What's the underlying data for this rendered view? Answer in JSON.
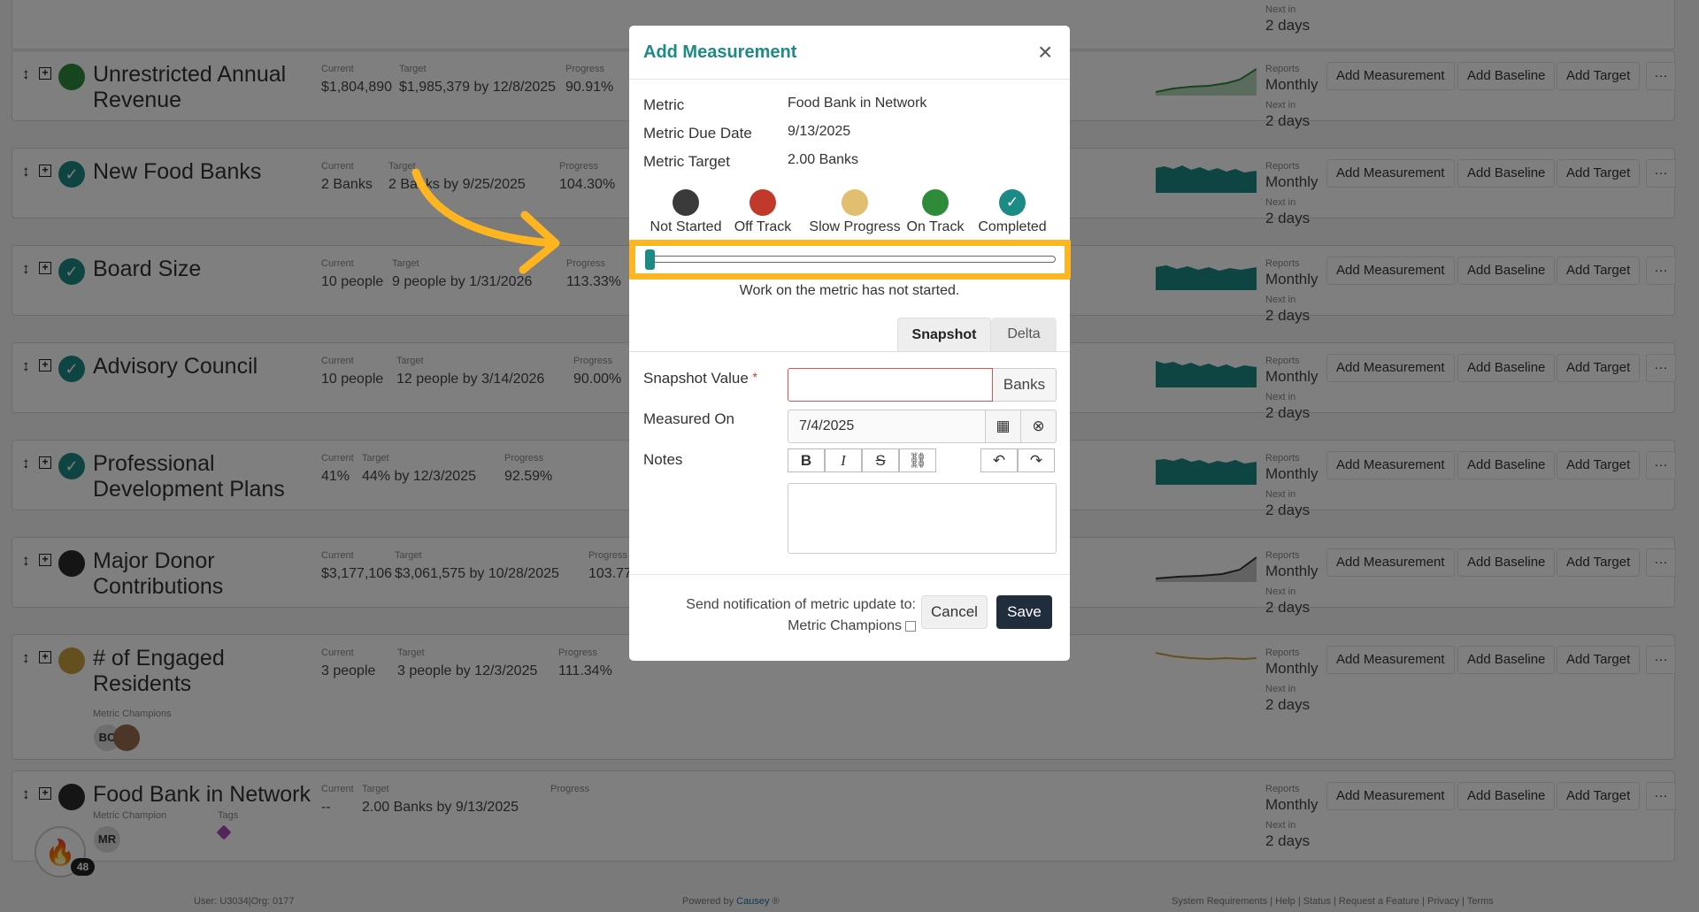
{
  "rows": [
    {
      "name": "",
      "status_color": "#bbb"
    },
    {
      "name": "Unrestricted Annual Revenue",
      "status_color": "#2e8b3a",
      "status_check": "",
      "current_label": "Current",
      "current_value": "$1,804,890",
      "target_label": "Target",
      "target_value": "$1,985,379 by 12/8/2025",
      "progress_label": "Progress",
      "progress_value": "90.91%",
      "spark_color": "#2e8b3a"
    },
    {
      "name": "New Food Banks",
      "status_color": "#1d8b85",
      "status_check": "✓",
      "current_label": "Current",
      "current_value": "2 Banks",
      "target_label": "Target",
      "target_value": "2 Banks by 9/25/2025",
      "progress_label": "Progress",
      "progress_value": "104.30%",
      "spark_color": "#1d8b85"
    },
    {
      "name": "Board Size",
      "status_color": "#1d8b85",
      "status_check": "✓",
      "current_label": "Current",
      "current_value": "10 people",
      "target_label": "Target",
      "target_value": "9 people by 1/31/2026",
      "progress_label": "Progress",
      "progress_value": "113.33%",
      "spark_color": "#1d8b85"
    },
    {
      "name": "Advisory Council",
      "status_color": "#1d8b85",
      "status_check": "✓",
      "current_label": "Current",
      "current_value": "10 people",
      "target_label": "Target",
      "target_value": "12 people by 3/14/2026",
      "progress_label": "Progress",
      "progress_value": "90.00%",
      "spark_color": "#1d8b85"
    },
    {
      "name": "Professional Development Plans",
      "status_color": "#1d8b85",
      "status_check": "✓",
      "current_label": "Current",
      "current_value": "41%",
      "target_label": "Target",
      "target_value": "44% by 12/3/2025",
      "progress_label": "Progress",
      "progress_value": "92.59%",
      "spark_color": "#1d8b85"
    },
    {
      "name": "Major Donor Contributions",
      "status_color": "#2b2b2b",
      "status_check": "",
      "current_label": "Current",
      "current_value": "$3,177,106",
      "target_label": "Target",
      "target_value": "$3,061,575 by 10/28/2025",
      "progress_label": "Progress",
      "progress_value": "103.77",
      "spark_color": "#333"
    },
    {
      "name": "# of Engaged Residents",
      "status_color": "#c8a03d",
      "status_check": "",
      "current_label": "Current",
      "current_value": "3 people",
      "target_label": "Target",
      "target_value": "3 people by 12/3/2025",
      "progress_label": "Progress",
      "progress_value": "111.34%",
      "spark_color": "#c8a03d",
      "champions_label": "Metric Champions",
      "champion_initials": "BC"
    },
    {
      "name": "Food Bank in Network",
      "status_color": "#2b2b2b",
      "status_check": "",
      "current_label": "Current",
      "current_value": "--",
      "target_label": "Target",
      "target_value": "2.00 Banks by 9/13/2025",
      "progress_label": "Progress",
      "progress_value": "",
      "champions_label": "Metric Champion",
      "champion_initials": "MR",
      "tags_label": "Tags"
    }
  ],
  "row_common": {
    "reports_label": "Reports",
    "reports_value": "Monthly",
    "next_label": "Next in",
    "next_value": "2 days",
    "add_measurement": "Add Measurement",
    "add_baseline": "Add Baseline",
    "add_target": "Add Target",
    "more": "···"
  },
  "fire_badge": {
    "count": "48"
  },
  "footer": {
    "user": "User: U3034|Org: 0177",
    "powered_prefix": "Powered by",
    "powered_brand": "Causey",
    "powered_suffix": "®",
    "links": "System Requirements | Help | Status | Request a Feature | Privacy | Terms"
  },
  "modal": {
    "title": "Add Measurement",
    "metric_label": "Metric",
    "metric_value": "Food Bank in Network",
    "due_label": "Metric Due Date",
    "due_value": "9/13/2025",
    "target_label": "Metric Target",
    "target_value": "2.00 Banks",
    "statuses": [
      {
        "label": "Not Started",
        "color": "#3a3a3a"
      },
      {
        "label": "Off Track",
        "color": "#c0392b"
      },
      {
        "label": "Slow Progress",
        "color": "#e0c070"
      },
      {
        "label": "On Track",
        "color": "#2e8b3a"
      },
      {
        "label": "Completed",
        "color": "#1d8b85"
      }
    ],
    "slider_level": 0,
    "status_message": "Work on the metric has not started.",
    "tabs": {
      "snapshot": "Snapshot",
      "delta": "Delta"
    },
    "snapshot_label": "Snapshot Value",
    "required_mark": "*",
    "snapshot_unit": "Banks",
    "measured_label": "Measured On",
    "measured_value": "7/4/2025",
    "notes_label": "Notes",
    "notify_line1": "Send notification of metric update to:",
    "notify_line2": "Metric Champions",
    "cancel": "Cancel",
    "save": "Save"
  },
  "colors": {
    "accent": "#1d8b85",
    "highlight": "#ffb520",
    "save_bg": "#1f2d3d"
  }
}
